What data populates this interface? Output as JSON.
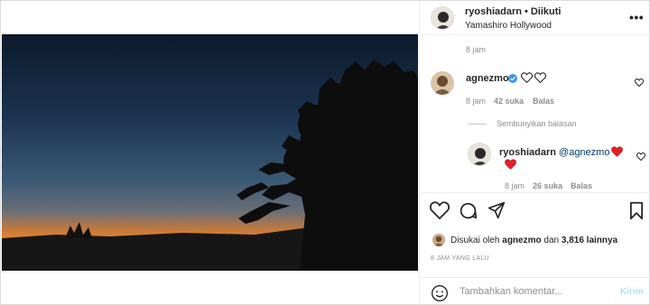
{
  "post": {
    "author": "ryoshiadarn",
    "separator": "•",
    "follow_status": "Diikuti",
    "location": "Yamashiro Hollywood",
    "caption_time": "8 jam"
  },
  "comments": [
    {
      "user": "agnezmo",
      "text": "",
      "time": "8 jam",
      "likes": "42 suka",
      "reply_label": "Balas",
      "hide_replies_label": "Sembunyikan balasan"
    }
  ],
  "reply": {
    "user": "ryoshiadarn",
    "mention": "@agnezmo",
    "time": "8 jam",
    "likes": "26 suka",
    "reply_label": "Balas"
  },
  "likes": {
    "prefix": "Disukai oleh",
    "first_user": "agnezmo",
    "connector": "dan",
    "others": "3,816 lainnya"
  },
  "timestamp": "8 JAM YANG LALU",
  "comment_box": {
    "placeholder": "Tambahkan komentar...",
    "post_label": "Kirim"
  },
  "colors": {
    "heart_red": "#ed4956",
    "verified_blue": "#3897f0",
    "post_button": "#b2dffc",
    "muted": "#8e8e8e"
  },
  "icons": {
    "more": "more-options-icon",
    "like": "heart-outline-icon",
    "comment": "comment-bubble-icon",
    "share": "paper-plane-icon",
    "save": "bookmark-icon",
    "emoji": "smiley-icon",
    "verified": "verified-badge-icon"
  }
}
